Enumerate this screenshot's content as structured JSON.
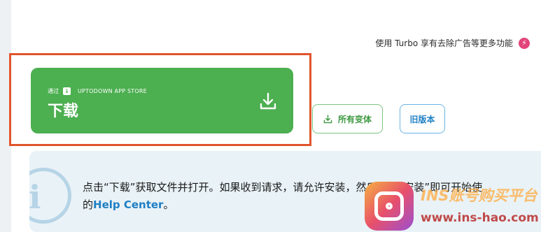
{
  "turbo": {
    "text": "使用 Turbo 享有去除广告等更多功能",
    "icon": "lightning-icon",
    "color": "#e2457a"
  },
  "download": {
    "via_label": "通过",
    "store_icon": "download-box-icon",
    "store_name": "UPTODOWN APP STORE",
    "label": "下载",
    "arrow_icon": "download-arrow-icon",
    "color": "#4caf50"
  },
  "buttons": {
    "variants": {
      "label": "所有变体",
      "icon": "download-icon"
    },
    "old_versions": {
      "label": "旧版本"
    }
  },
  "info": {
    "icon": "info-icon",
    "text_part1": "点击“下载”获取文件并打开。如果收到请求，请允许安装，然后点击“安装”即可开始使",
    "text_part2": "的",
    "link": "Help Center",
    "text_end": "。"
  },
  "watermark": {
    "title": "INS账号购买平台",
    "url": "www.ins-hao.com",
    "logo": "instagram-logo-icon"
  },
  "colors": {
    "highlight": "#e0552c",
    "link": "#1e7fc4"
  }
}
